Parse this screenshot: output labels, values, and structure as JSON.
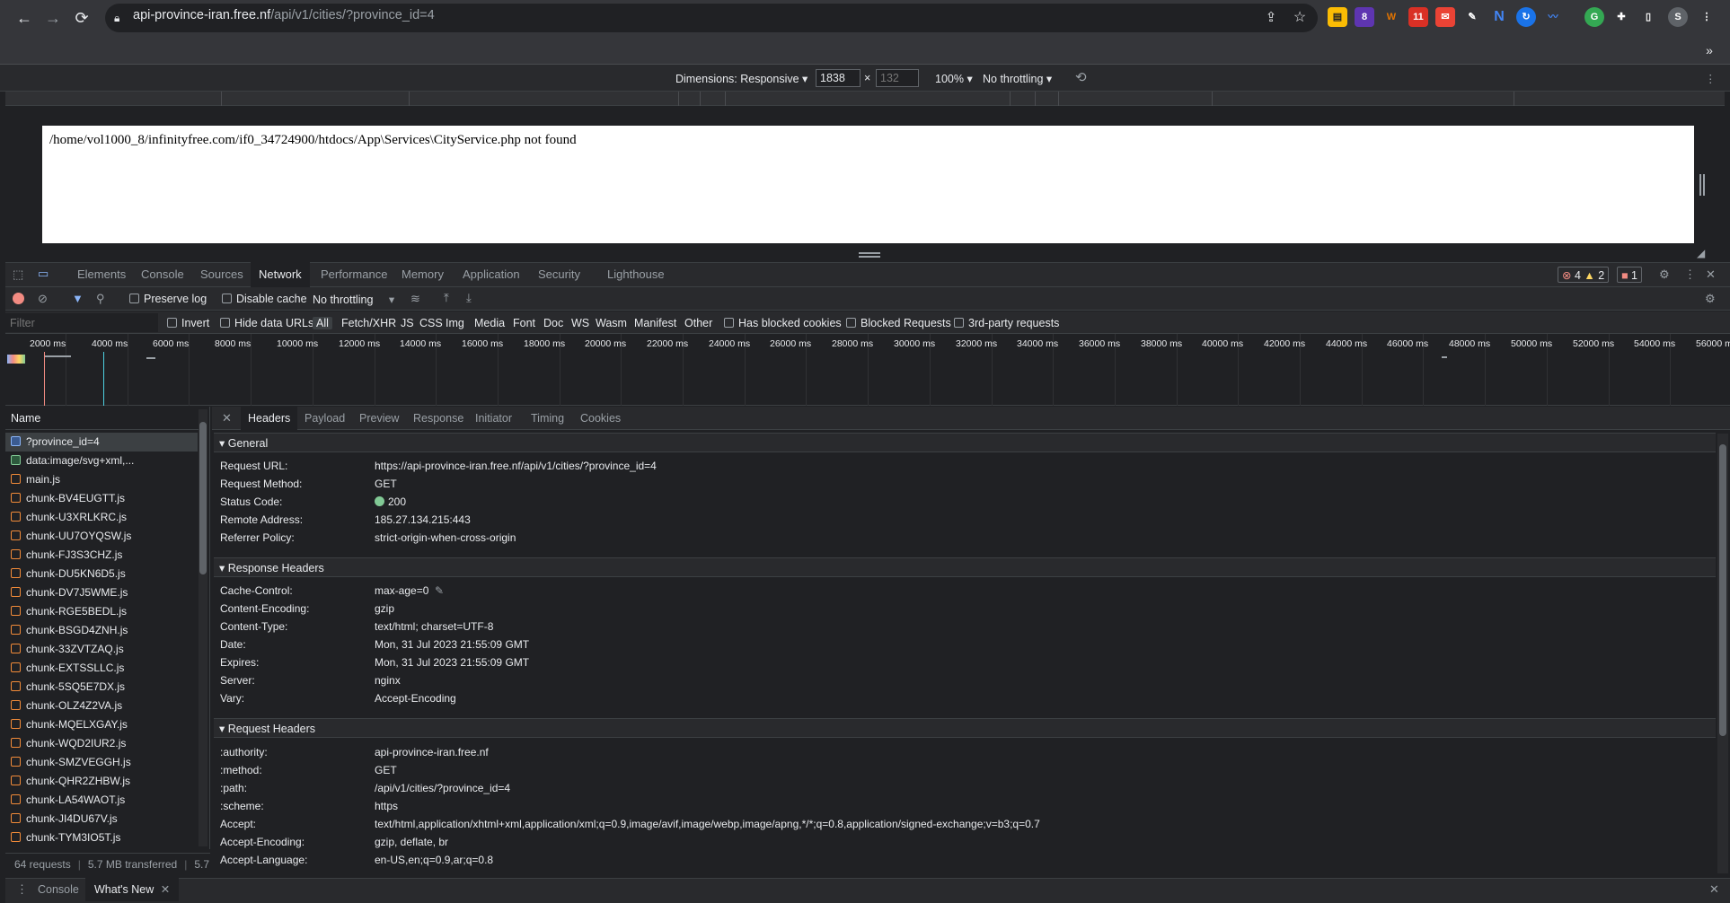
{
  "browser": {
    "url_host": "api-province-iran.free.nf",
    "url_path": "/api/v1/cities/?province_id=4",
    "profile_initial": "S",
    "ext_badge_1": "8",
    "ext_badge_2": "11"
  },
  "device_toolbar": {
    "dimensions_label": "Dimensions: Responsive",
    "width_value": "1838",
    "times": "×",
    "height_placeholder": "132",
    "zoom": "100%",
    "throttling": "No throttling"
  },
  "page": {
    "message": "/home/vol1000_8/infinityfree.com/if0_34724900/htdocs/App\\Services\\CityService.php not found"
  },
  "devtools": {
    "tabs": [
      "Elements",
      "Console",
      "Sources",
      "Network",
      "Performance",
      "Memory",
      "Application",
      "Security",
      "Lighthouse"
    ],
    "errors": "4",
    "warnings": "2",
    "issues": "1"
  },
  "network_toolbar": {
    "preserve_log": "Preserve log",
    "disable_cache": "Disable cache",
    "throttling": "No throttling"
  },
  "filter_bar": {
    "placeholder": "Filter",
    "invert": "Invert",
    "hide_data_urls": "Hide data URLs",
    "types": [
      "All",
      "Fetch/XHR",
      "JS",
      "CSS",
      "Img",
      "Media",
      "Font",
      "Doc",
      "WS",
      "Wasm",
      "Manifest",
      "Other"
    ],
    "has_blocked_cookies": "Has blocked cookies",
    "blocked_requests": "Blocked Requests",
    "third_party": "3rd-party requests"
  },
  "timeline": {
    "ticks": [
      "2000 ms",
      "4000 ms",
      "6000 ms",
      "8000 ms",
      "10000 ms",
      "12000 ms",
      "14000 ms",
      "16000 ms",
      "18000 ms",
      "20000 ms",
      "22000 ms",
      "24000 ms",
      "26000 ms",
      "28000 ms",
      "30000 ms",
      "32000 ms",
      "34000 ms",
      "36000 ms",
      "38000 ms",
      "40000 ms",
      "42000 ms",
      "44000 ms",
      "46000 ms",
      "48000 ms",
      "50000 ms",
      "52000 ms",
      "54000 ms",
      "56000 ms"
    ]
  },
  "requests": {
    "header": "Name",
    "items": [
      {
        "name": "?province_id=4",
        "kind": "doc"
      },
      {
        "name": "data:image/svg+xml,...",
        "kind": "img"
      },
      {
        "name": "main.js",
        "kind": "js"
      },
      {
        "name": "chunk-BV4EUGTT.js",
        "kind": "js"
      },
      {
        "name": "chunk-U3XRLKRC.js",
        "kind": "js"
      },
      {
        "name": "chunk-UU7OYQSW.js",
        "kind": "js"
      },
      {
        "name": "chunk-FJ3S3CHZ.js",
        "kind": "js"
      },
      {
        "name": "chunk-DU5KN6D5.js",
        "kind": "js"
      },
      {
        "name": "chunk-DV7J5WME.js",
        "kind": "js"
      },
      {
        "name": "chunk-RGE5BEDL.js",
        "kind": "js"
      },
      {
        "name": "chunk-BSGD4ZNH.js",
        "kind": "js"
      },
      {
        "name": "chunk-33ZVTZAQ.js",
        "kind": "js"
      },
      {
        "name": "chunk-EXTSSLLC.js",
        "kind": "js"
      },
      {
        "name": "chunk-5SQ5E7DX.js",
        "kind": "js"
      },
      {
        "name": "chunk-OLZ4Z2VA.js",
        "kind": "js"
      },
      {
        "name": "chunk-MQELXGAY.js",
        "kind": "js"
      },
      {
        "name": "chunk-WQD2IUR2.js",
        "kind": "js"
      },
      {
        "name": "chunk-SMZVEGGH.js",
        "kind": "js"
      },
      {
        "name": "chunk-QHR2ZHBW.js",
        "kind": "js"
      },
      {
        "name": "chunk-LA54WAOT.js",
        "kind": "js"
      },
      {
        "name": "chunk-JI4DU67V.js",
        "kind": "js"
      },
      {
        "name": "chunk-TYM3IO5T.js",
        "kind": "js"
      }
    ],
    "status": {
      "requests": "64 requests",
      "transferred": "5.7 MB transferred",
      "resources": "5.7"
    }
  },
  "details": {
    "tabs": [
      "Headers",
      "Payload",
      "Preview",
      "Response",
      "Initiator",
      "Timing",
      "Cookies"
    ],
    "general": {
      "title": "General",
      "rows": [
        {
          "k": "Request URL:",
          "v": "https://api-province-iran.free.nf/api/v1/cities/?province_id=4"
        },
        {
          "k": "Request Method:",
          "v": "GET"
        },
        {
          "k": "Status Code:",
          "v": "200"
        },
        {
          "k": "Remote Address:",
          "v": "185.27.134.215:443"
        },
        {
          "k": "Referrer Policy:",
          "v": "strict-origin-when-cross-origin"
        }
      ]
    },
    "response_headers": {
      "title": "Response Headers",
      "rows": [
        {
          "k": "Cache-Control:",
          "v": "max-age=0"
        },
        {
          "k": "Content-Encoding:",
          "v": "gzip"
        },
        {
          "k": "Content-Type:",
          "v": "text/html; charset=UTF-8"
        },
        {
          "k": "Date:",
          "v": "Mon, 31 Jul 2023 21:55:09 GMT"
        },
        {
          "k": "Expires:",
          "v": "Mon, 31 Jul 2023 21:55:09 GMT"
        },
        {
          "k": "Server:",
          "v": "nginx"
        },
        {
          "k": "Vary:",
          "v": "Accept-Encoding"
        }
      ]
    },
    "request_headers": {
      "title": "Request Headers",
      "rows": [
        {
          "k": ":authority:",
          "v": "api-province-iran.free.nf"
        },
        {
          "k": ":method:",
          "v": "GET"
        },
        {
          "k": ":path:",
          "v": "/api/v1/cities/?province_id=4"
        },
        {
          "k": ":scheme:",
          "v": "https"
        },
        {
          "k": "Accept:",
          "v": "text/html,application/xhtml+xml,application/xml;q=0.9,image/avif,image/webp,image/apng,*/*;q=0.8,application/signed-exchange;v=b3;q=0.7"
        },
        {
          "k": "Accept-Encoding:",
          "v": "gzip, deflate, br"
        },
        {
          "k": "Accept-Language:",
          "v": "en-US,en;q=0.9,ar;q=0.8"
        }
      ]
    }
  },
  "drawer": {
    "tabs": [
      "Console",
      "What's New"
    ]
  },
  "colors": {
    "status_ok": "#81c995",
    "accent": "#8ab4f8",
    "error": "#f28b82",
    "warning": "#fdd663"
  }
}
